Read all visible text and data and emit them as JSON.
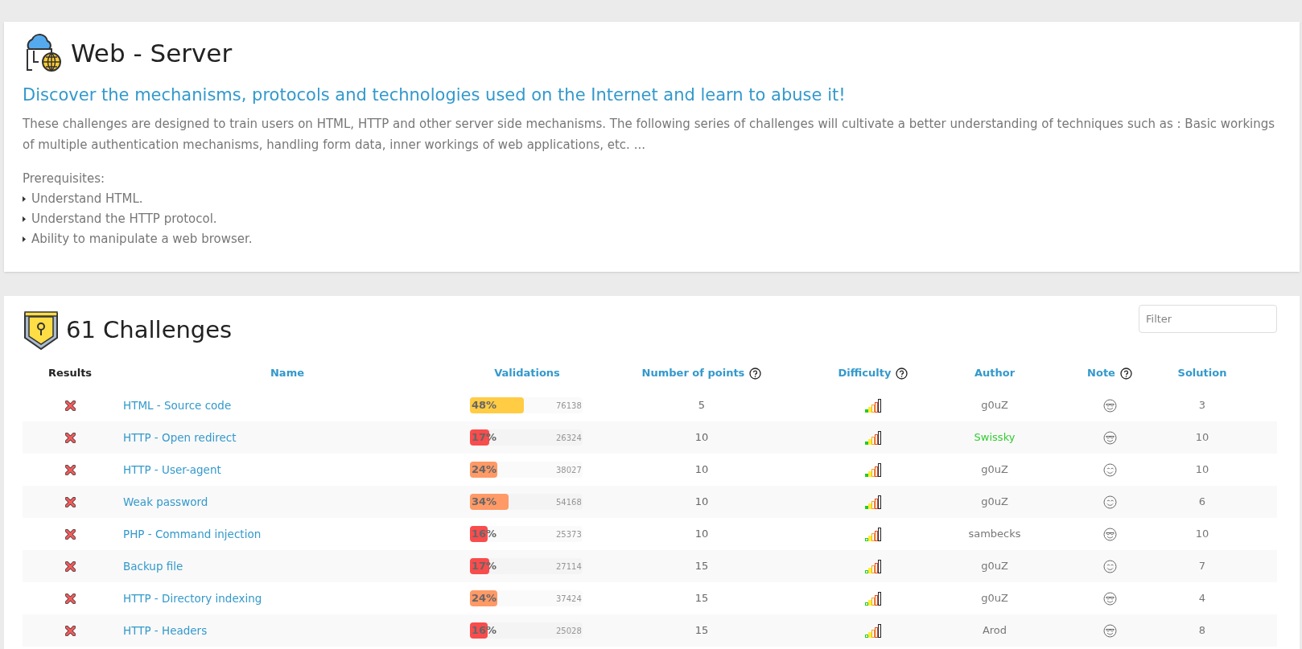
{
  "header": {
    "title": "Web - Server",
    "subtitle": "Discover the mechanisms, protocols and technologies used on the Internet and learn to abuse it!",
    "description": "These challenges are designed to train users on HTML, HTTP and other server side mechanisms. The following series of challenges will cultivate a better understanding of techniques such as : Basic workings of multiple authentication mechanisms, handling form data, inner workings of web applications, etc. ...",
    "prerequisites_label": "Prerequisites:",
    "prerequisites": [
      "Understand HTML.",
      "Understand the HTTP protocol.",
      "Ability to manipulate a web browser."
    ]
  },
  "challenges": {
    "title": "61 Challenges",
    "filter": {
      "placeholder": "Filter"
    },
    "columns": [
      {
        "label": "Results",
        "kind": "plain"
      },
      {
        "label": "Name",
        "kind": "link"
      },
      {
        "label": "Validations",
        "kind": "link"
      },
      {
        "label": "Number of points",
        "kind": "help"
      },
      {
        "label": "Difficulty",
        "kind": "help"
      },
      {
        "label": "Author",
        "kind": "link"
      },
      {
        "label": "Note",
        "kind": "help"
      },
      {
        "label": "Solution",
        "kind": "link"
      }
    ],
    "rows": [
      {
        "validated": false,
        "name": "HTML - Source code",
        "percent": "48%",
        "level": 0.48,
        "color": "#ffcc44",
        "count": "76138",
        "points": "5",
        "first_bar_filled": true,
        "author": {
          "name": "g0uZ",
          "color": "#777777"
        },
        "note": {
          "kind": "cool"
        },
        "solutions": "3"
      },
      {
        "validated": false,
        "name": "HTTP - Open redirect",
        "percent": "17%",
        "level": 0.17,
        "color": "#f94c4c",
        "count": "26324",
        "points": "10",
        "first_bar_filled": true,
        "author": {
          "name": "Swissky",
          "color": "#33cc33"
        },
        "note": {
          "kind": "cool"
        },
        "solutions": "10"
      },
      {
        "validated": false,
        "name": "HTTP - User-agent",
        "percent": "24%",
        "level": 0.24,
        "color": "#ff9966",
        "count": "38027",
        "points": "10",
        "first_bar_filled": true,
        "author": {
          "name": "g0uZ",
          "color": "#777777"
        },
        "note": {
          "kind": "smile"
        },
        "solutions": "10"
      },
      {
        "validated": false,
        "name": "Weak password",
        "percent": "34%",
        "level": 0.34,
        "color": "#ff9966",
        "count": "54168",
        "points": "10",
        "first_bar_filled": true,
        "author": {
          "name": "g0uZ",
          "color": "#777777"
        },
        "note": {
          "kind": "smile"
        },
        "solutions": "6"
      },
      {
        "validated": false,
        "name": "PHP - Command injection",
        "percent": "16%",
        "level": 0.16,
        "color": "#f94c4c",
        "count": "25373",
        "points": "10",
        "first_bar_filled": false,
        "author": {
          "name": "sambecks",
          "color": "#777777"
        },
        "note": {
          "kind": "cool"
        },
        "solutions": "10"
      },
      {
        "validated": false,
        "name": "Backup file",
        "percent": "17%",
        "level": 0.17,
        "color": "#f94c4c",
        "count": "27114",
        "points": "15",
        "first_bar_filled": false,
        "author": {
          "name": "g0uZ",
          "color": "#777777"
        },
        "note": {
          "kind": "smile"
        },
        "solutions": "7"
      },
      {
        "validated": false,
        "name": "HTTP - Directory indexing",
        "percent": "24%",
        "level": 0.24,
        "color": "#ff9966",
        "count": "37424",
        "points": "15",
        "first_bar_filled": false,
        "author": {
          "name": "g0uZ",
          "color": "#777777"
        },
        "note": {
          "kind": "cool"
        },
        "solutions": "4"
      },
      {
        "validated": false,
        "name": "HTTP - Headers",
        "percent": "16%",
        "level": 0.16,
        "color": "#f94c4c",
        "count": "25028",
        "points": "15",
        "first_bar_filled": false,
        "author": {
          "name": "Arod",
          "color": "#777777"
        },
        "note": {
          "kind": "cool"
        },
        "solutions": "8"
      }
    ]
  }
}
